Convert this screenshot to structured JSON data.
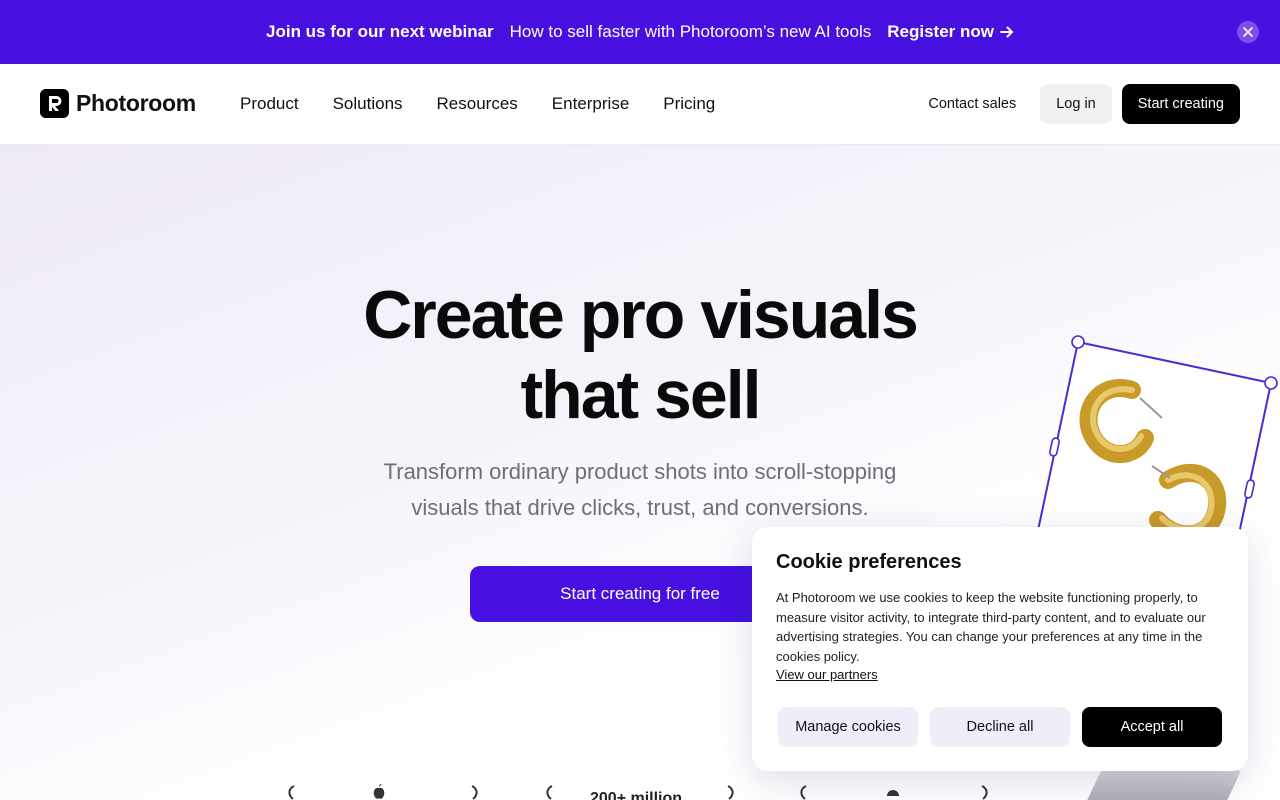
{
  "banner": {
    "lead": "Join us for our next webinar",
    "text": "How to sell faster with Photoroom’s new AI tools",
    "cta": "Register now",
    "cta_icon": "arrow-right-icon",
    "close_icon": "close-icon"
  },
  "nav": {
    "brand": "Photoroom",
    "menu": [
      "Product",
      "Solutions",
      "Resources",
      "Enterprise",
      "Pricing"
    ],
    "contact": "Contact sales",
    "login": "Log in",
    "start": "Start creating"
  },
  "hero": {
    "title_line1": "Create pro visuals",
    "title_line2": "that sell",
    "subtitle_line1": "Transform ordinary product shots into scroll-stopping",
    "subtitle_line2": "visuals that drive clicks, trust, and conversions.",
    "cta": "Start creating for free",
    "stat": "200+ million"
  },
  "cookie": {
    "title": "Cookie preferences",
    "body": "At Photoroom we use cookies to keep the website functioning properly, to measure visitor activity, to integrate third-party content, and to evaluate our advertising strategies. You can change your preferences at any time in the cookies policy.",
    "partners": "View our partners",
    "manage": "Manage cookies",
    "decline": "Decline all",
    "accept": "Accept all"
  },
  "colors": {
    "accent": "#4510e0",
    "dark": "#000000"
  }
}
